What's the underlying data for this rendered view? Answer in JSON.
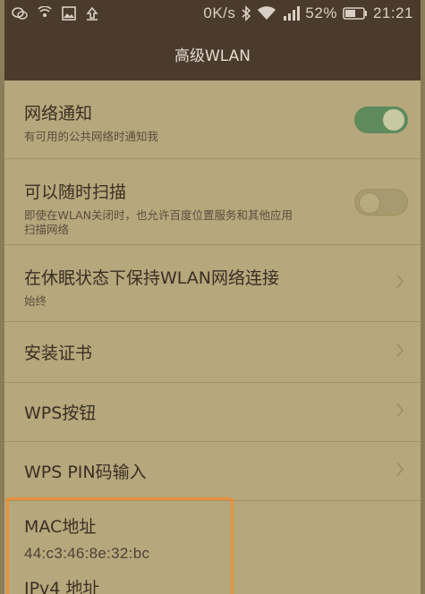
{
  "status_bar": {
    "network_speed": "0K/s",
    "battery": "52%",
    "time": "21:21",
    "icons": [
      "wechat-icon",
      "wifi-hotspot-icon",
      "image-icon",
      "upload-icon",
      "bluetooth-icon",
      "wifi-icon",
      "signal-icon",
      "battery-icon"
    ]
  },
  "title": "高级WLAN",
  "settings": {
    "network_notify": {
      "title": "网络通知",
      "subtitle": "有可用的公共网络时通知我",
      "enabled": true
    },
    "scan_always": {
      "title": "可以随时扫描",
      "subtitle": "即使在WLAN关闭时，也允许百度位置服务和其他应用扫描网络",
      "subtitle_line1": "即使在WLAN关闭时，也允许百度位置服务和其他应用",
      "subtitle_line2": "扫描网络",
      "enabled": false
    },
    "keep_wlan_sleep": {
      "title": "在休眠状态下保持WLAN网络连接",
      "subtitle": "始终"
    },
    "install_cert": {
      "title": "安装证书"
    },
    "wps_button": {
      "title": "WPS按钮"
    },
    "wps_pin": {
      "title": "WPS PIN码输入"
    },
    "mac": {
      "label": "MAC地址",
      "value": "44:c3:46:8e:32:bc"
    },
    "ipv4": {
      "label": "IPv4 地址"
    }
  },
  "colors": {
    "toolbar": "#4b3b2d",
    "background": "#b6a77c",
    "toggle_on": "#5f8a5c",
    "highlight": "#e8923b"
  }
}
